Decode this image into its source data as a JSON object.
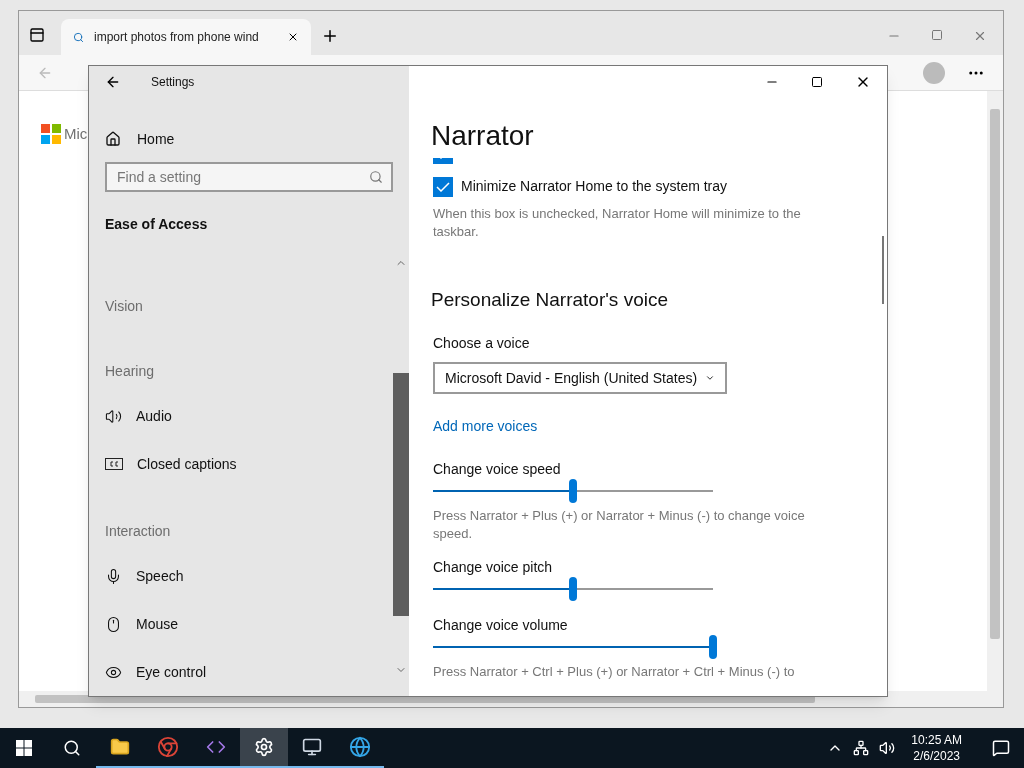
{
  "browser": {
    "tab": {
      "title": "import photos from phone wind",
      "selected": true
    },
    "page_logo_text": "Mic"
  },
  "settings": {
    "title": "Settings",
    "home": {
      "label": "Home"
    },
    "search": {
      "placeholder": "Find a setting"
    },
    "category": "Ease of Access",
    "nav": [
      {
        "kind": "heading",
        "label": "Vision"
      },
      {
        "kind": "heading",
        "label": "Hearing"
      },
      {
        "kind": "item",
        "label": "Audio",
        "selected": false
      },
      {
        "kind": "item",
        "label": "Closed captions",
        "selected": false
      },
      {
        "kind": "heading",
        "label": "Interaction"
      },
      {
        "kind": "item",
        "label": "Speech",
        "selected": false
      },
      {
        "kind": "item",
        "label": "Mouse",
        "selected": false
      },
      {
        "kind": "item",
        "label": "Eye control",
        "selected": false
      }
    ],
    "page_title": "Narrator",
    "clipped_checkbox": {
      "checked": true
    },
    "checkbox": {
      "label": "Minimize Narrator Home to the system tray",
      "checked": true
    },
    "checkbox_note": "When this box is unchecked, Narrator Home will minimize to the taskbar.",
    "section_heading": "Personalize Narrator's voice",
    "voice_label": "Choose a voice",
    "voice_value": "Microsoft David - English (United States)",
    "link": "Add more voices",
    "sliders": [
      {
        "label": "Change voice speed",
        "level": 0.5,
        "hint": "Press Narrator + Plus (+) or Narrator + Minus (-) to change voice speed."
      },
      {
        "label": "Change voice pitch",
        "level": 0.5
      },
      {
        "label": "Change voice volume",
        "level": 1.0,
        "hint": "Press Narrator + Ctrl + Plus (+) or Narrator + Ctrl + Minus (-) to"
      }
    ]
  },
  "taskbar": {
    "apps": [
      {
        "running": true,
        "selected": false
      },
      {
        "running": true,
        "selected": false
      },
      {
        "running": true,
        "selected": false
      },
      {
        "running": true,
        "selected": true
      },
      {
        "running": true,
        "selected": false
      },
      {
        "running": true,
        "selected": false
      }
    ],
    "time": "10:25 AM",
    "date": "2/6/2023"
  }
}
